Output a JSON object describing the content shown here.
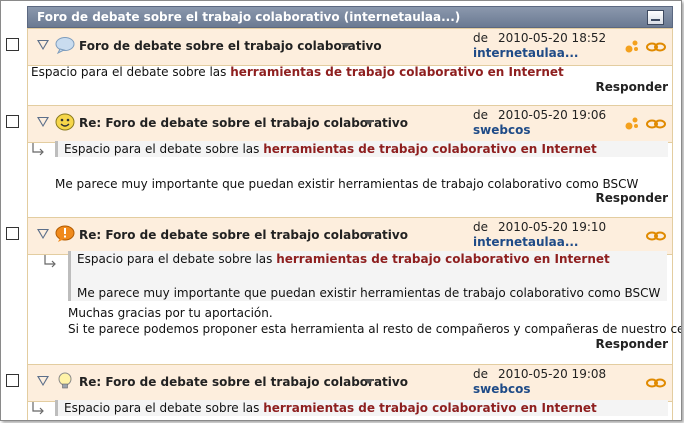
{
  "forum_title": "Foro de debate sobre el trabajo colaborativo (internetaulaa...)",
  "de_label": "de",
  "reply_label": "Responder",
  "quote_text_plain": "Espacio para el debate sobre las ",
  "quote_text_highlight": "herramientas de trabajo colaborativo en Internet",
  "posts": [
    {
      "subject": "Foro de debate sobre el trabajo colaborativo",
      "date": "2010-05-20 18:52",
      "author": "internetaulaa...",
      "body": "Espacio para el debate sobre las ",
      "body_highlight": "herramientas de trabajo colaborativo en Internet"
    },
    {
      "subject": "Re: Foro de debate sobre el trabajo colaborativo",
      "date": "2010-05-20 19:06",
      "author": "swebcos",
      "body": "Me parece muy importante que puedan existir herramientas de trabajo colaborativo como BSCW"
    },
    {
      "subject": "Re: Foro de debate sobre el trabajo colaborativo",
      "date": "2010-05-20 19:10",
      "author": "internetaulaa...",
      "quote_body": "Me parece muy importante que puedan existir herramientas de trabajo colaborativo como BSCW",
      "body_line1": "Muchas gracias por tu aportación.",
      "body_line2": "Si te parece podemos proponer esta herramienta al resto de compañeros y compañeras de nuestro centro."
    },
    {
      "subject": "Re: Foro de debate sobre el trabajo colaborativo",
      "date": "2010-05-20 19:08",
      "author": "swebcos"
    }
  ],
  "colors": {
    "header_bg": "#fdeedd",
    "title_bar": "#7b889f",
    "highlight": "#8e1f1f",
    "author": "#1f4b87"
  },
  "icons": {
    "post_icons": [
      "speech-bubble-icon",
      "smiley-icon",
      "exclamation-icon",
      "lightbulb-icon"
    ],
    "peers": "people-icon",
    "link": "chain-link-icon",
    "reply": "reply-arrow-icon"
  }
}
